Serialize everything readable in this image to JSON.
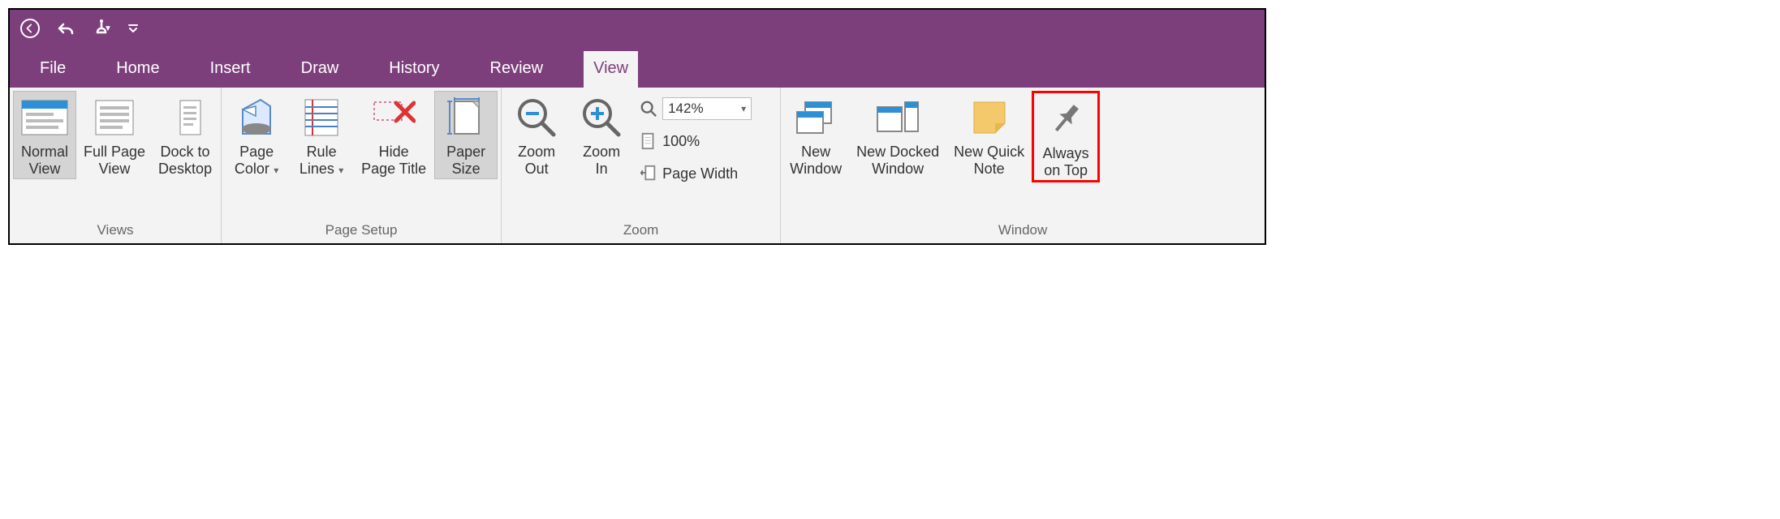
{
  "tabs": {
    "file": "File",
    "home": "Home",
    "insert": "Insert",
    "draw": "Draw",
    "history": "History",
    "review": "Review",
    "view": "View"
  },
  "groups": {
    "views": {
      "label": "Views",
      "normal_view": "Normal\nView",
      "full_page_view": "Full Page\nView",
      "dock_to_desktop": "Dock to\nDesktop"
    },
    "page_setup": {
      "label": "Page Setup",
      "page_color": "Page\nColor",
      "rule_lines": "Rule\nLines",
      "hide_page_title": "Hide\nPage Title",
      "paper_size": "Paper\nSize"
    },
    "zoom": {
      "label": "Zoom",
      "zoom_out": "Zoom\nOut",
      "zoom_in": "Zoom\nIn",
      "zoom_value": "142%",
      "hundred": "100%",
      "page_width": "Page Width"
    },
    "window": {
      "label": "Window",
      "new_window": "New\nWindow",
      "new_docked_window": "New Docked\nWindow",
      "new_quick_note": "New Quick\nNote",
      "always_on_top": "Always\non Top"
    }
  }
}
